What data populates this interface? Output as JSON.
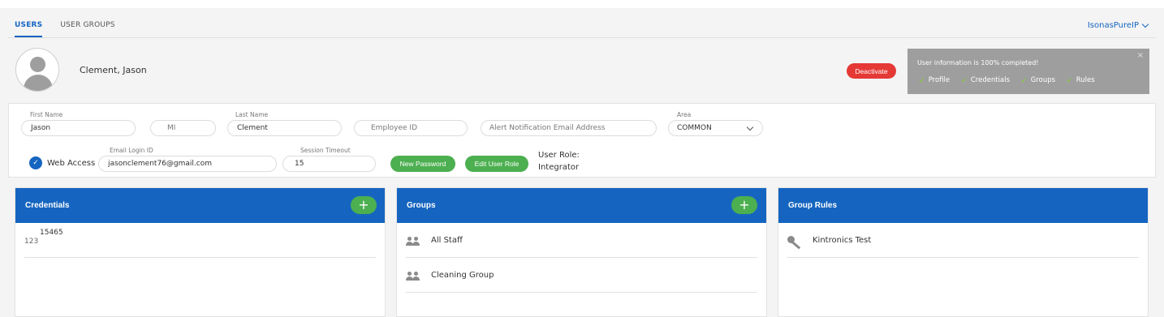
{
  "tabs": [
    {
      "label": "USERS",
      "active": true
    },
    {
      "label": "USER GROUPS",
      "active": false
    }
  ],
  "org_selector": {
    "label": "IsonasPureIP"
  },
  "user": {
    "name": "Clement, Jason"
  },
  "header_actions": {
    "deactivate_label": "Deactivate"
  },
  "completion": {
    "message": "User information is 100% completed!",
    "close_glyph": "×",
    "items": [
      "Profile",
      "Credentials",
      "Groups",
      "Rules"
    ]
  },
  "form": {
    "first_name": {
      "label": "First Name",
      "value": "Jason"
    },
    "middle_initial": {
      "placeholder": "MI"
    },
    "last_name": {
      "label": "Last Name",
      "value": "Clement"
    },
    "employee_id": {
      "placeholder": "Employee ID"
    },
    "alert_email": {
      "placeholder": "Alert Notification Email Address"
    },
    "area": {
      "label": "Area",
      "value": "COMMON"
    },
    "web_access": {
      "label": "Web Access",
      "checked": true
    },
    "email_login": {
      "label": "Email Login ID",
      "value": "jasonclement76@gmail.com"
    },
    "session_timeout": {
      "label": "Session Timeout",
      "value": "15"
    },
    "new_password_label": "New Password",
    "edit_user_role_label": "Edit User Role",
    "user_role_label": "User Role:",
    "user_role_value": "Integrator"
  },
  "panels": {
    "credentials": {
      "title": "Credentials",
      "add_glyph": "+",
      "items": [
        {
          "icon_text": "123",
          "value": "15465"
        }
      ]
    },
    "groups": {
      "title": "Groups",
      "add_glyph": "+",
      "items": [
        "All Staff",
        "Cleaning Group"
      ]
    },
    "group_rules": {
      "title": "Group Rules",
      "items": [
        "Kintronics Test"
      ]
    }
  },
  "colors": {
    "primary": "#1565c0",
    "success": "#4caf50",
    "danger": "#e53935",
    "status_bg": "#9e9e9e"
  }
}
